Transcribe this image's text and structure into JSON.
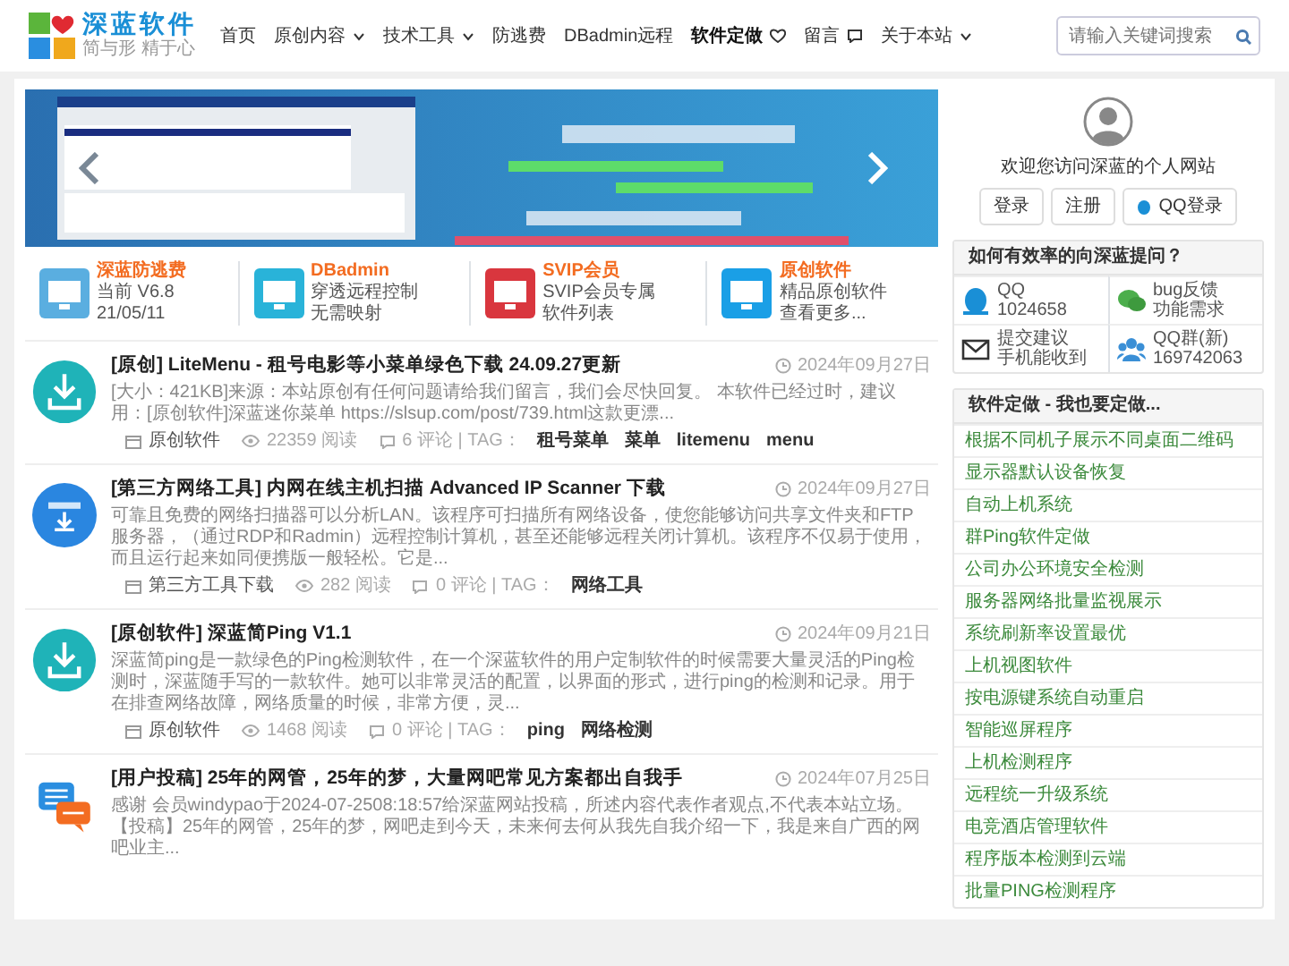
{
  "header": {
    "logo_title": "深蓝软件",
    "logo_slogan": "简与形 精于心",
    "nav": [
      {
        "label": "首页",
        "kind": "plain",
        "selected": false
      },
      {
        "label": "原创内容",
        "kind": "dropdown",
        "selected": false
      },
      {
        "label": "技术工具",
        "kind": "dropdown",
        "selected": false
      },
      {
        "label": "防逃费",
        "kind": "plain",
        "selected": false
      },
      {
        "label": "DBadmin远程",
        "kind": "plain",
        "selected": false
      },
      {
        "label": "软件定做",
        "kind": "heart",
        "selected": true
      },
      {
        "label": "留言",
        "kind": "chat",
        "selected": false
      },
      {
        "label": "关于本站",
        "kind": "dropdown",
        "selected": false
      }
    ],
    "search": {
      "placeholder": "请输入关键词搜索"
    }
  },
  "features": [
    {
      "title": "深蓝防逃费",
      "line_1": "当前 V6.8",
      "line_2": "21/05/11",
      "color": "#5aaee0"
    },
    {
      "title": "DBadmin",
      "line_1": "穿透远程控制",
      "line_2": "无需映射",
      "color": "#29b3d9"
    },
    {
      "title": "SVIP会员",
      "line_1": "SVIP会员专属",
      "line_2": "软件列表",
      "color": "#d9363e"
    },
    {
      "title": "原创软件",
      "line_1": "精品原创软件",
      "line_2": "查看更多...",
      "color": "#1a9fe6"
    }
  ],
  "articles": [
    {
      "kind": "download",
      "title": "[原创] LiteMenu - 租号电影等小菜单绿色下载 24.09.27更新",
      "date": "2024年09月27日",
      "excerpt": "[大小：421KB]来源：本站原创有任何问题请给我们留言，我们会尽快回复。 本软件已经过时，建议用：[原创软件]深蓝迷你菜单 https://slsup.com/post/739.html这款更漂...",
      "category": "原创软件",
      "views": "22359 阅读",
      "comments": "6 评论 | TAG：",
      "tags": [
        "租号菜单",
        "菜单",
        "litemenu",
        "menu"
      ]
    },
    {
      "kind": "tool",
      "title": "[第三方网络工具] 内网在线主机扫描 Advanced IP Scanner 下载",
      "date": "2024年09月27日",
      "excerpt": "可靠且免费的网络扫描器可以分析LAN。该程序可扫描所有网络设备，使您能够访问共享文件夹和FTP服务器，（通过RDP和Radmin）远程控制计算机，甚至还能够远程关闭计算机。该程序不仅易于使用，而且运行起来如同便携版一般轻松。它是...",
      "category": "第三方工具下载",
      "views": "282 阅读",
      "comments": "0 评论 | TAG：",
      "tags": [
        "网络工具"
      ]
    },
    {
      "kind": "download",
      "title": "[原创软件] 深蓝简Ping V1.1",
      "date": "2024年09月21日",
      "excerpt": "深蓝简ping是一款绿色的Ping检测软件，在一个深蓝软件的用户定制软件的时候需要大量灵活的Ping检测时，深蓝随手写的一款软件。她可以非常灵活的配置，以界面的形式，进行ping的检测和记录。用于在排查网络故障，网络质量的时候，非常方便，灵...",
      "category": "原创软件",
      "views": "1468 阅读",
      "comments": "0 评论 | TAG：",
      "tags": [
        "ping",
        "网络检测"
      ]
    },
    {
      "kind": "chat",
      "title": "[用户投稿] 25年的网管，25年的梦，大量网吧常见方案都出自我手",
      "date": "2024年07月25日",
      "excerpt": "感谢 会员windypao于2024-07-2508:18:57给深蓝网站投稿，所述内容代表作者观点,不代表本站立场。【投稿】25年的网管，25年的梦，网吧走到今天，未来何去何从我先自我介绍一下，我是来自广西的网吧业主..."
    }
  ],
  "sidebar": {
    "welcome": "欢迎您访问深蓝的个人网站",
    "buttons": [
      {
        "label": "登录",
        "kind": "plain"
      },
      {
        "label": "注册",
        "kind": "plain"
      },
      {
        "label": "QQ登录",
        "kind": "qq"
      }
    ],
    "contact": {
      "title": "如何有效率的向深蓝提问？",
      "items": [
        {
          "kind": "qq",
          "line_1": "QQ",
          "line_2": "1024658"
        },
        {
          "kind": "wechat",
          "line_1": "bug反馈",
          "line_2": "功能需求"
        },
        {
          "kind": "mail",
          "line_1": "提交建议",
          "line_2": "手机能收到"
        },
        {
          "kind": "group",
          "line_1": "QQ群(新)",
          "line_2": "169742063"
        }
      ]
    },
    "custom": {
      "title": "软件定做 - 我也要定做...",
      "items": [
        "根据不同机子展示不同桌面二维码",
        "显示器默认设备恢复",
        "自动上机系统",
        "群Ping软件定做",
        "公司办公环境安全检测",
        "服务器网络批量监视展示",
        "系统刷新率设置最优",
        "上机视图软件",
        "按电源键系统自动重启",
        "智能巡屏程序",
        "上机检测程序",
        "远程统一升级系统",
        "电竞酒店管理软件",
        "程序版本检测到云端",
        "批量PING检测程序"
      ]
    }
  }
}
